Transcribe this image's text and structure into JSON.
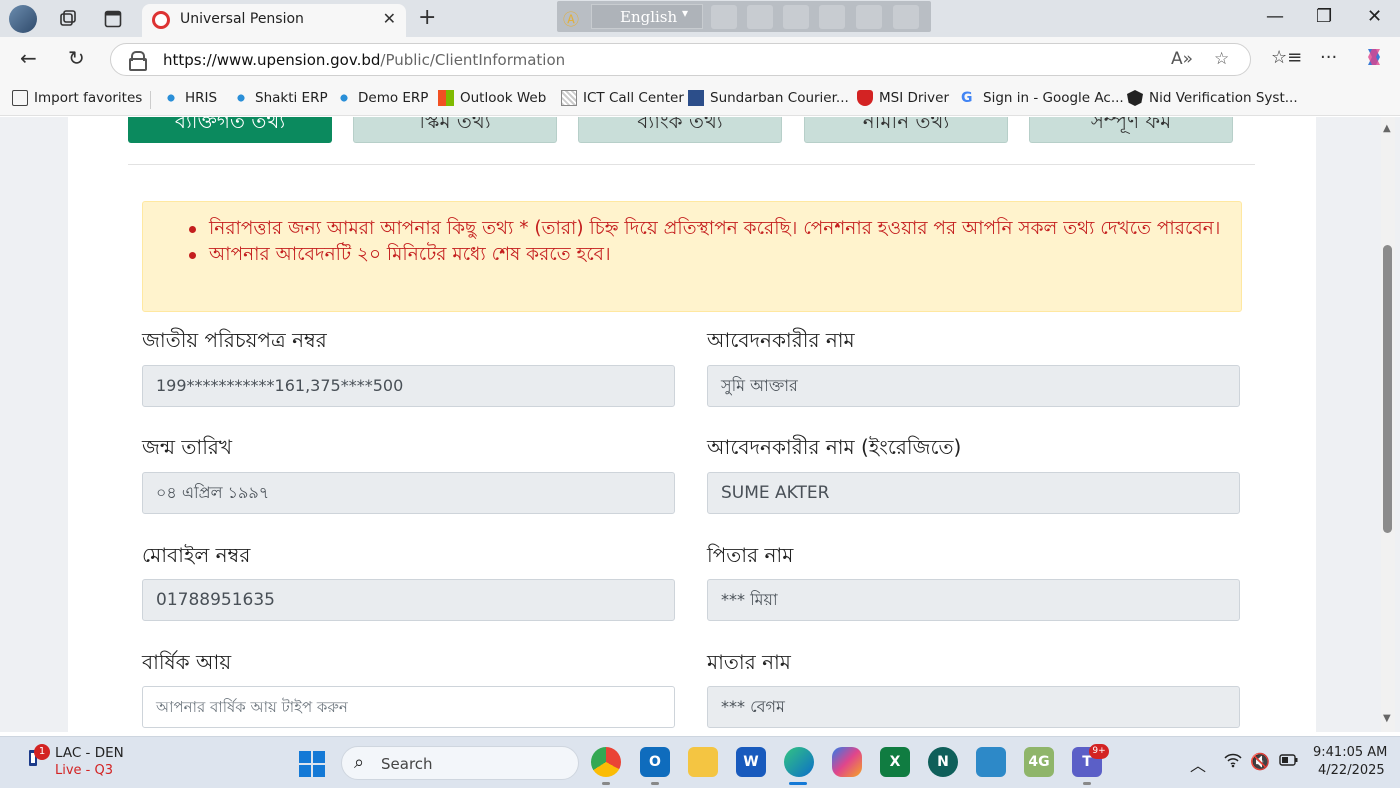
{
  "browser": {
    "tab_title": "Universal Pension",
    "url_host": "https://www.upension.gov.bd",
    "url_path": "/Public/ClientInformation",
    "ime_language": "English"
  },
  "bookmarks": [
    {
      "label": "Import favorites"
    },
    {
      "label": "HRIS"
    },
    {
      "label": "Shakti ERP"
    },
    {
      "label": "Demo ERP"
    },
    {
      "label": "Outlook Web"
    },
    {
      "label": "ICT Call Center"
    },
    {
      "label": "Sundarban Courier..."
    },
    {
      "label": "MSI Driver"
    },
    {
      "label": "Sign in - Google Ac..."
    },
    {
      "label": "Nid Verification Syst..."
    }
  ],
  "steps": [
    {
      "label": "ব্যক্তিগত তথ্য"
    },
    {
      "label": "স্কিম তথ্য"
    },
    {
      "label": "ব্যাংক তথ্য"
    },
    {
      "label": "নমিনি তথ্য"
    },
    {
      "label": "সম্পূর্ণ ফর্ম"
    }
  ],
  "notice": {
    "line1": "নিরাপত্তার জন্য আমরা আপনার কিছু তথ্য * (তারা) চিহ্ন দিয়ে প্রতিস্থাপন করেছি। পেনশনার হওয়ার পর আপনি সকল তথ্য দেখতে পারবেন।",
    "line2": "আপনার আবেদনটি ২০ মিনিটের মধ্যে শেষ করতে হবে।"
  },
  "form": {
    "nid_label": "জাতীয় পরিচয়পত্র নম্বর",
    "nid_value": "199***********161,375****500",
    "name_label": "আবেদনকারীর নাম",
    "name_value": "সুমি আক্তার",
    "dob_label": "জন্ম তারিখ",
    "dob_value": "০৪ এপ্রিল ১৯৯৭",
    "name_en_label": "আবেদনকারীর নাম (ইংরেজিতে)",
    "name_en_value": "SUME AKTER",
    "mobile_label": "মোবাইল নম্বর",
    "mobile_value": "01788951635",
    "father_label": "পিতার নাম",
    "father_value": "*** মিয়া",
    "income_label": "বার্ষিক আয়",
    "income_placeholder": "আপনার বার্ষিক আয় টাইপ করুন",
    "mother_label": "মাতার নাম",
    "mother_value": "*** বেগম"
  },
  "taskbar": {
    "weather_title": "LAC - DEN",
    "weather_sub": "Live - Q3",
    "notification_count": "1",
    "search_label": "Search",
    "teams_badge": "9+",
    "time": "9:41:05 AM",
    "date": "4/22/2025"
  }
}
